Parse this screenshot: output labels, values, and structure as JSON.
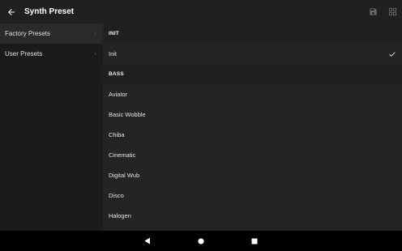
{
  "appbar": {
    "title": "Synth Preset",
    "icons": [
      "back-arrow-icon",
      "save-icon",
      "grid-icon"
    ]
  },
  "sidebar": {
    "items": [
      {
        "label": "Factory Presets",
        "icon": "chevron-right-icon",
        "active": true
      },
      {
        "label": "User Presets",
        "icon": "chevron-right-icon",
        "active": false
      }
    ]
  },
  "main": {
    "sections": [
      {
        "header": "INIT",
        "items": [
          {
            "label": "Init",
            "selected": true
          }
        ]
      },
      {
        "header": "BASS",
        "items": [
          {
            "label": "Aviator"
          },
          {
            "label": "Basic Wobble"
          },
          {
            "label": "Chiba"
          },
          {
            "label": "Cinematic"
          },
          {
            "label": "Digital Wub"
          },
          {
            "label": "Disco"
          },
          {
            "label": "Halogen"
          }
        ]
      }
    ]
  },
  "navbar": {
    "icons": [
      "back-triangle-icon",
      "home-circle-icon",
      "recents-square-icon"
    ]
  },
  "colors": {
    "background": "#202020",
    "sidebar": "#1b1b1b",
    "content": "#242424",
    "navbar": "#000000",
    "text": "#e6e6e6"
  }
}
